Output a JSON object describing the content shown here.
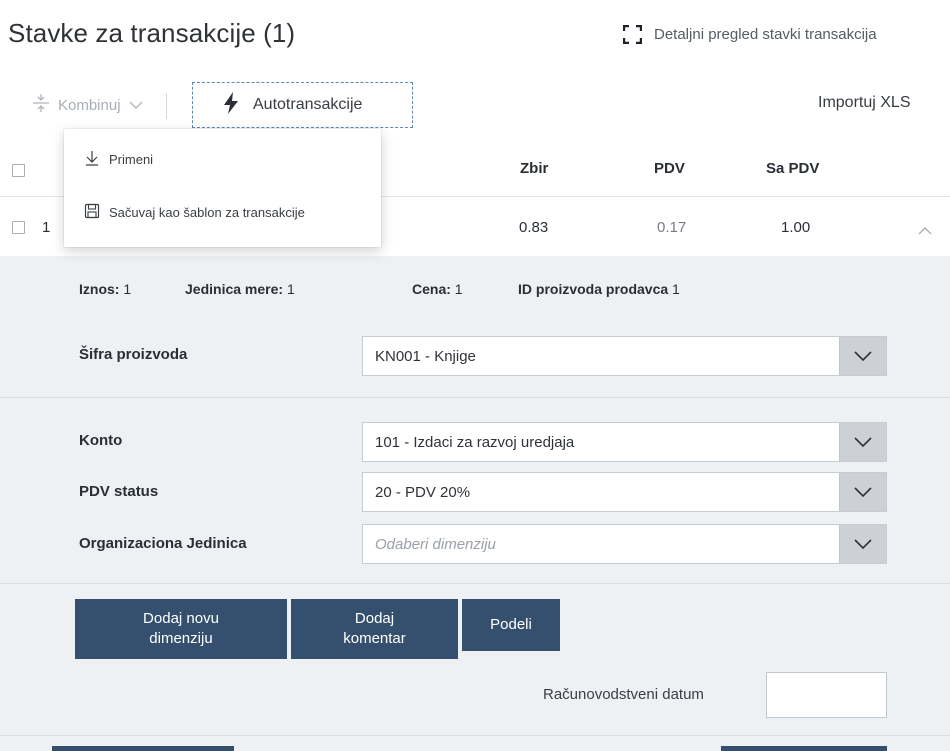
{
  "header": {
    "title": "Stavke za transakcije (1)",
    "detail_link": "Detaljni pregled stavki transakcija"
  },
  "toolbar": {
    "combine_label": "Kombinuj",
    "auto_label": "Autotransakcije",
    "import_label": "Importuj XLS"
  },
  "menu": {
    "items": [
      {
        "label": "Primeni",
        "icon": "download-arrow-icon"
      },
      {
        "label": "Sačuvaj kao šablon za transakcije",
        "icon": "save-disk-icon"
      }
    ]
  },
  "table": {
    "columns": [
      "Zbir",
      "PDV",
      "Sa PDV"
    ],
    "row": {
      "index": "1",
      "sum": "0.83",
      "vat": "0.17",
      "total": "1.00"
    }
  },
  "details": {
    "amount_label": "Iznos:",
    "amount_value": "1",
    "unit_label": "Jedinica mere:",
    "unit_value": "1",
    "price_label": "Cena:",
    "price_value": "1",
    "vendor_id_label": "ID proizvoda prodavca",
    "vendor_id_value": "1"
  },
  "fields": {
    "product_code": {
      "label": "Šifra proizvoda",
      "value": "KN001 - Knjige"
    },
    "account": {
      "label": "Konto",
      "value": "101 - Izdaci za razvoj uredjaja"
    },
    "vat_status": {
      "label": "PDV status",
      "value": "20 - PDV 20%"
    },
    "org_unit": {
      "label": "Organizaciona Jedinica",
      "placeholder": "Odaberi dimenziju"
    }
  },
  "buttons": {
    "add_dimension": [
      "Dodaj novu",
      "dimenziju"
    ],
    "add_comment": [
      "Dodaj",
      "komentar"
    ],
    "split": "Podeli"
  },
  "accounting_date_label": "Računovodstveni datum",
  "colors": {
    "primary": "#35506e",
    "panel": "#eef1f4",
    "dashed_border": "#5b87b7"
  }
}
